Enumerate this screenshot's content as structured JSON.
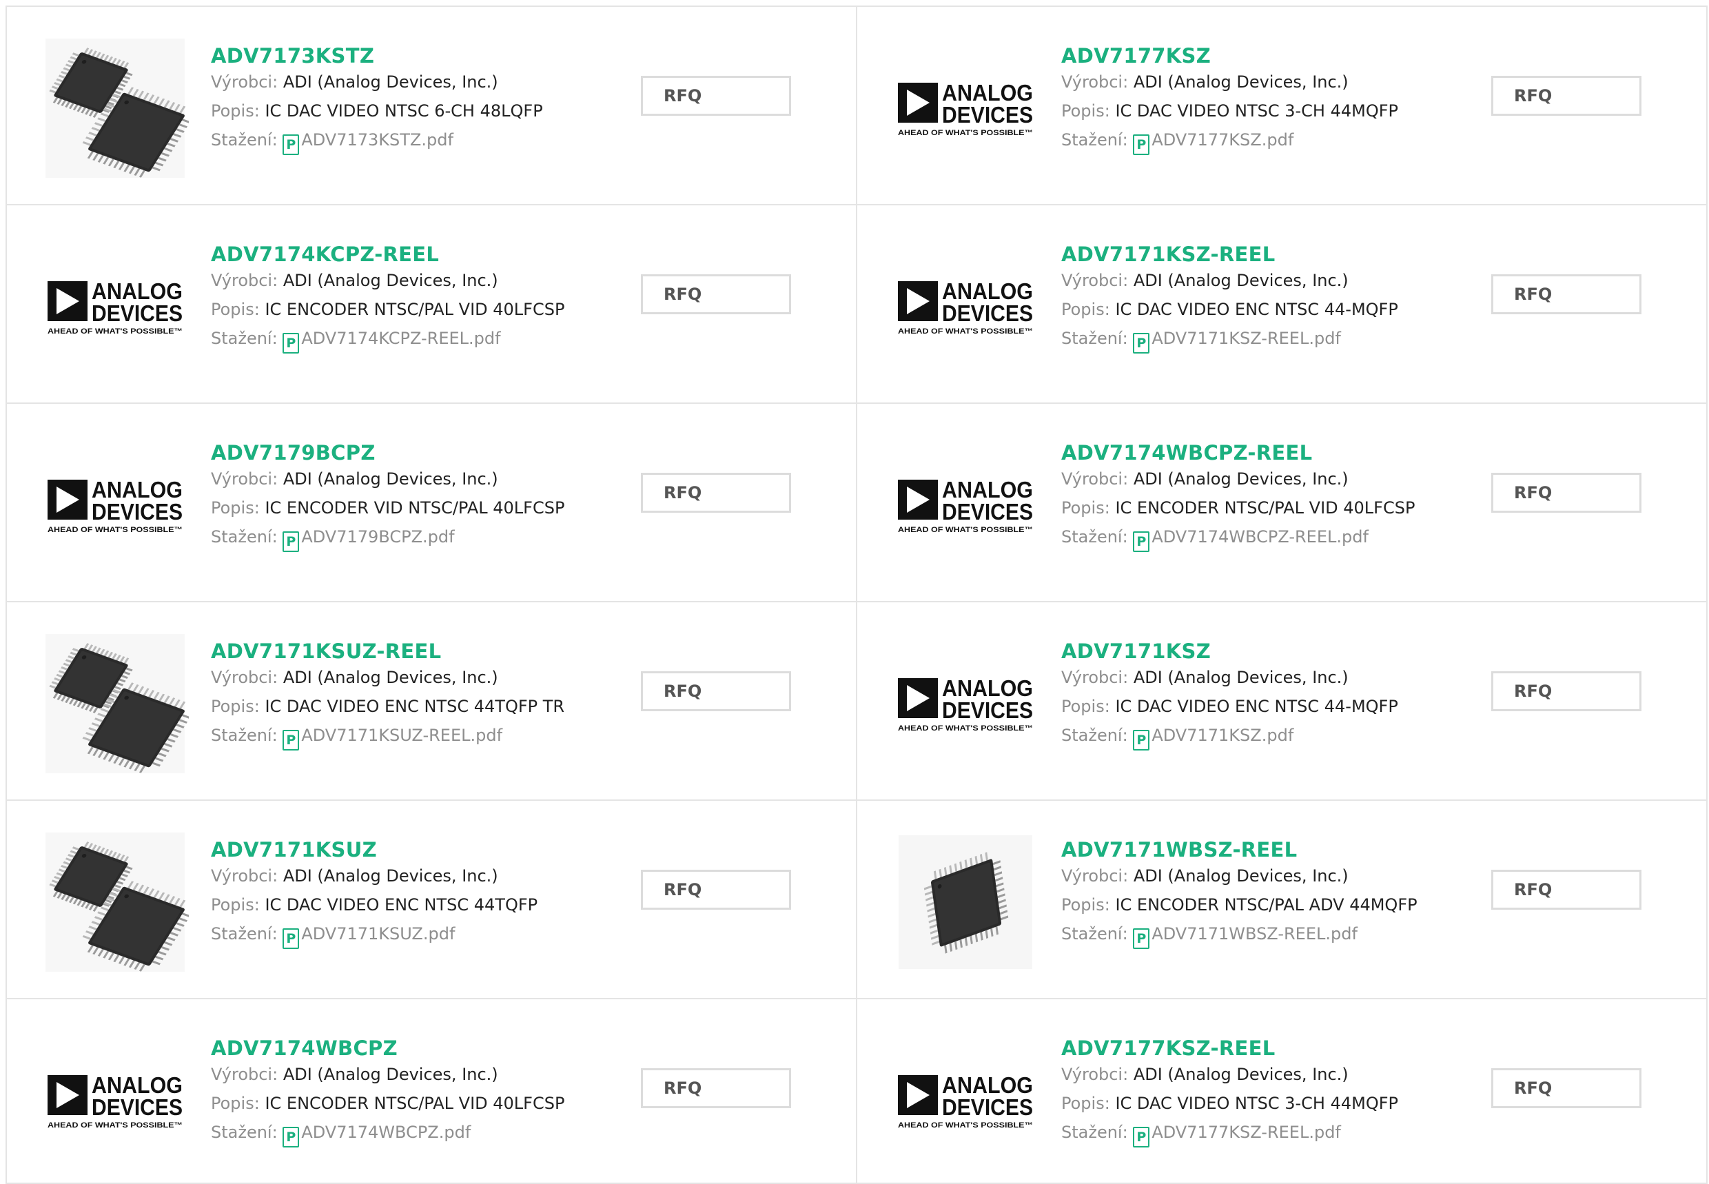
{
  "colors": {
    "accent": "#1bb07f",
    "label": "#8e8e8e",
    "border": "#e4e4e4"
  },
  "labels": {
    "manufacturer": "Výrobci:",
    "description": "Popis:",
    "download": "Stažení:",
    "rfq": "RFQ"
  },
  "logo": {
    "line1": "ANALOG",
    "line2": "DEVICES",
    "tagline": "AHEAD OF WHAT'S POSSIBLE™"
  },
  "pdf_icon_glyph": "P",
  "products": [
    {
      "name": "ADV7173KSTZ",
      "manufacturer": "ADI (Analog Devices, Inc.)",
      "description": "IC DAC VIDEO NTSC 6-CH 48LQFP",
      "file": "ADV7173KSTZ.pdf",
      "image": "chip-pair-icon"
    },
    {
      "name": "ADV7177KSZ",
      "manufacturer": "ADI (Analog Devices, Inc.)",
      "description": "IC DAC VIDEO NTSC 3-CH 44MQFP",
      "file": "ADV7177KSZ.pdf",
      "image": "analog-devices-logo"
    },
    {
      "name": "ADV7174KCPZ-REEL",
      "manufacturer": "ADI (Analog Devices, Inc.)",
      "description": "IC ENCODER NTSC/PAL VID 40LFCSP",
      "file": "ADV7174KCPZ-REEL.pdf",
      "image": "analog-devices-logo"
    },
    {
      "name": "ADV7171KSZ-REEL",
      "manufacturer": "ADI (Analog Devices, Inc.)",
      "description": "IC DAC VIDEO ENC NTSC 44-MQFP",
      "file": "ADV7171KSZ-REEL.pdf",
      "image": "analog-devices-logo"
    },
    {
      "name": "ADV7179BCPZ",
      "manufacturer": "ADI (Analog Devices, Inc.)",
      "description": "IC ENCODER VID NTSC/PAL 40LFCSP",
      "file": "ADV7179BCPZ.pdf",
      "image": "analog-devices-logo"
    },
    {
      "name": "ADV7174WBCPZ-REEL",
      "manufacturer": "ADI (Analog Devices, Inc.)",
      "description": "IC ENCODER NTSC/PAL VID 40LFCSP",
      "file": "ADV7174WBCPZ-REEL.pdf",
      "image": "analog-devices-logo"
    },
    {
      "name": "ADV7171KSUZ-REEL",
      "manufacturer": "ADI (Analog Devices, Inc.)",
      "description": "IC DAC VIDEO ENC NTSC 44TQFP TR",
      "file": "ADV7171KSUZ-REEL.pdf",
      "image": "chip-pair-icon"
    },
    {
      "name": "ADV7171KSZ",
      "manufacturer": "ADI (Analog Devices, Inc.)",
      "description": "IC DAC VIDEO ENC NTSC 44-MQFP",
      "file": "ADV7171KSZ.pdf",
      "image": "analog-devices-logo"
    },
    {
      "name": "ADV7171KSUZ",
      "manufacturer": "ADI (Analog Devices, Inc.)",
      "description": "IC DAC VIDEO ENC NTSC 44TQFP",
      "file": "ADV7171KSUZ.pdf",
      "image": "chip-pair-icon"
    },
    {
      "name": "ADV7171WBSZ-REEL",
      "manufacturer": "ADI (Analog Devices, Inc.)",
      "description": "IC ENCODER NTSC/PAL ADV 44MQFP",
      "file": "ADV7171WBSZ-REEL.pdf",
      "image": "chip-single-icon"
    },
    {
      "name": "ADV7174WBCPZ",
      "manufacturer": "ADI (Analog Devices, Inc.)",
      "description": "IC ENCODER NTSC/PAL VID 40LFCSP",
      "file": "ADV7174WBCPZ.pdf",
      "image": "analog-devices-logo"
    },
    {
      "name": "ADV7177KSZ-REEL",
      "manufacturer": "ADI (Analog Devices, Inc.)",
      "description": "IC DAC VIDEO NTSC 3-CH 44MQFP",
      "file": "ADV7177KSZ-REEL.pdf",
      "image": "analog-devices-logo"
    }
  ]
}
